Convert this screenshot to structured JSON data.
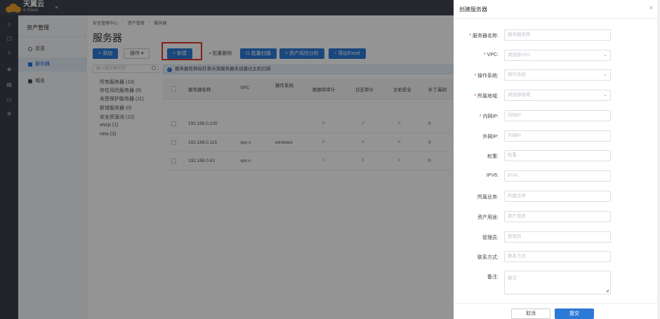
{
  "brand": {
    "name_cn": "天翼云",
    "name_en": "e Cloud"
  },
  "rail_icons": [
    "home-icon",
    "window-icon",
    "alert-icon",
    "cube-icon",
    "document-icon",
    "monitor-icon",
    "settings-icon"
  ],
  "nav2": {
    "title": "资产管理",
    "items": [
      {
        "label": "总览",
        "icon": "circle-icon",
        "active": false
      },
      {
        "label": "服务器",
        "icon": "server-icon",
        "active": true
      },
      {
        "label": "域名",
        "icon": "domain-icon",
        "active": false
      }
    ]
  },
  "breadcrumb": [
    "安全管理中心",
    "资产管理",
    "服务器"
  ],
  "page_title": "服务器",
  "left_actions": {
    "add_label": "+ 添加",
    "ops_label": "操作 ▾"
  },
  "tree": {
    "search_placeholder": "输入服务器名称",
    "items": [
      "所有服务器 (13)",
      "存在风险服务器 (6)",
      "未受保护服务器 (11)",
      "新增服务器 (0)",
      "安全资源池 (12)",
      "wvcp (1)",
      "new (3)"
    ]
  },
  "toolbar": {
    "new_label": "+ 新建",
    "batch_delete_label": "批量删除",
    "batch_scan_label": "批量扫描",
    "risk_label": "+ 资产风险分析",
    "export_label": "↑ 导出Excel"
  },
  "notice": "服务器名称标红表示该服务器未创建过主机扫描",
  "table": {
    "headers": [
      "服务器名称",
      "VPC",
      "操作系统",
      "数据库审计",
      "日志审计",
      "主机安全",
      "补丁漏洞"
    ],
    "rows": [
      {
        "name": "192.168.0.105",
        "vpc": "",
        "os": "",
        "dbaudit": "×",
        "logaudit": "✓",
        "hostsec": "×",
        "patch": "0"
      },
      {
        "name": "192.168.0.115",
        "vpc": "vpc-c",
        "os": "windows",
        "dbaudit": "×",
        "logaudit": "×",
        "hostsec": "×",
        "patch": "0"
      },
      {
        "name": "192.168.0.61",
        "vpc": "vpc-c",
        "os": "",
        "dbaudit": "×",
        "logaudit": "×",
        "hostsec": "×",
        "patch": "0"
      }
    ]
  },
  "drawer": {
    "title": "创建服务器",
    "close": "×",
    "fields": [
      {
        "label": "服务器名称:",
        "required": true,
        "placeholder": "服务器名称",
        "type": "input"
      },
      {
        "label": "VPC:",
        "required": true,
        "placeholder": "请选择VPC",
        "type": "select"
      },
      {
        "label": "操作系统:",
        "required": true,
        "placeholder": "操作系统",
        "type": "select"
      },
      {
        "label": "所属地域:",
        "required": true,
        "placeholder": "请选择地域",
        "type": "select"
      },
      {
        "label": "内网IP:",
        "required": true,
        "placeholder": "内网IP",
        "type": "input"
      },
      {
        "label": "外网IP:",
        "required": false,
        "placeholder": "外网IP",
        "type": "input"
      },
      {
        "label": "权重:",
        "required": false,
        "placeholder": "权重",
        "type": "input"
      },
      {
        "label": "IPV6:",
        "required": false,
        "placeholder": "IPV6",
        "type": "input"
      },
      {
        "label": "所属业务:",
        "required": false,
        "placeholder": "所属业务",
        "type": "input"
      },
      {
        "label": "资产用途:",
        "required": false,
        "placeholder": "资产用途",
        "type": "input"
      },
      {
        "label": "管理员:",
        "required": false,
        "placeholder": "管理员",
        "type": "input"
      },
      {
        "label": "联系方式:",
        "required": false,
        "placeholder": "联系方式",
        "type": "input"
      },
      {
        "label": "备注:",
        "required": false,
        "placeholder": "备注",
        "type": "textarea"
      }
    ],
    "cancel_label": "取消",
    "submit_label": "提交"
  },
  "colors": {
    "primary": "#2d7ad6",
    "highlight_box": "#e03a2f",
    "topbar": "#3f4650"
  }
}
